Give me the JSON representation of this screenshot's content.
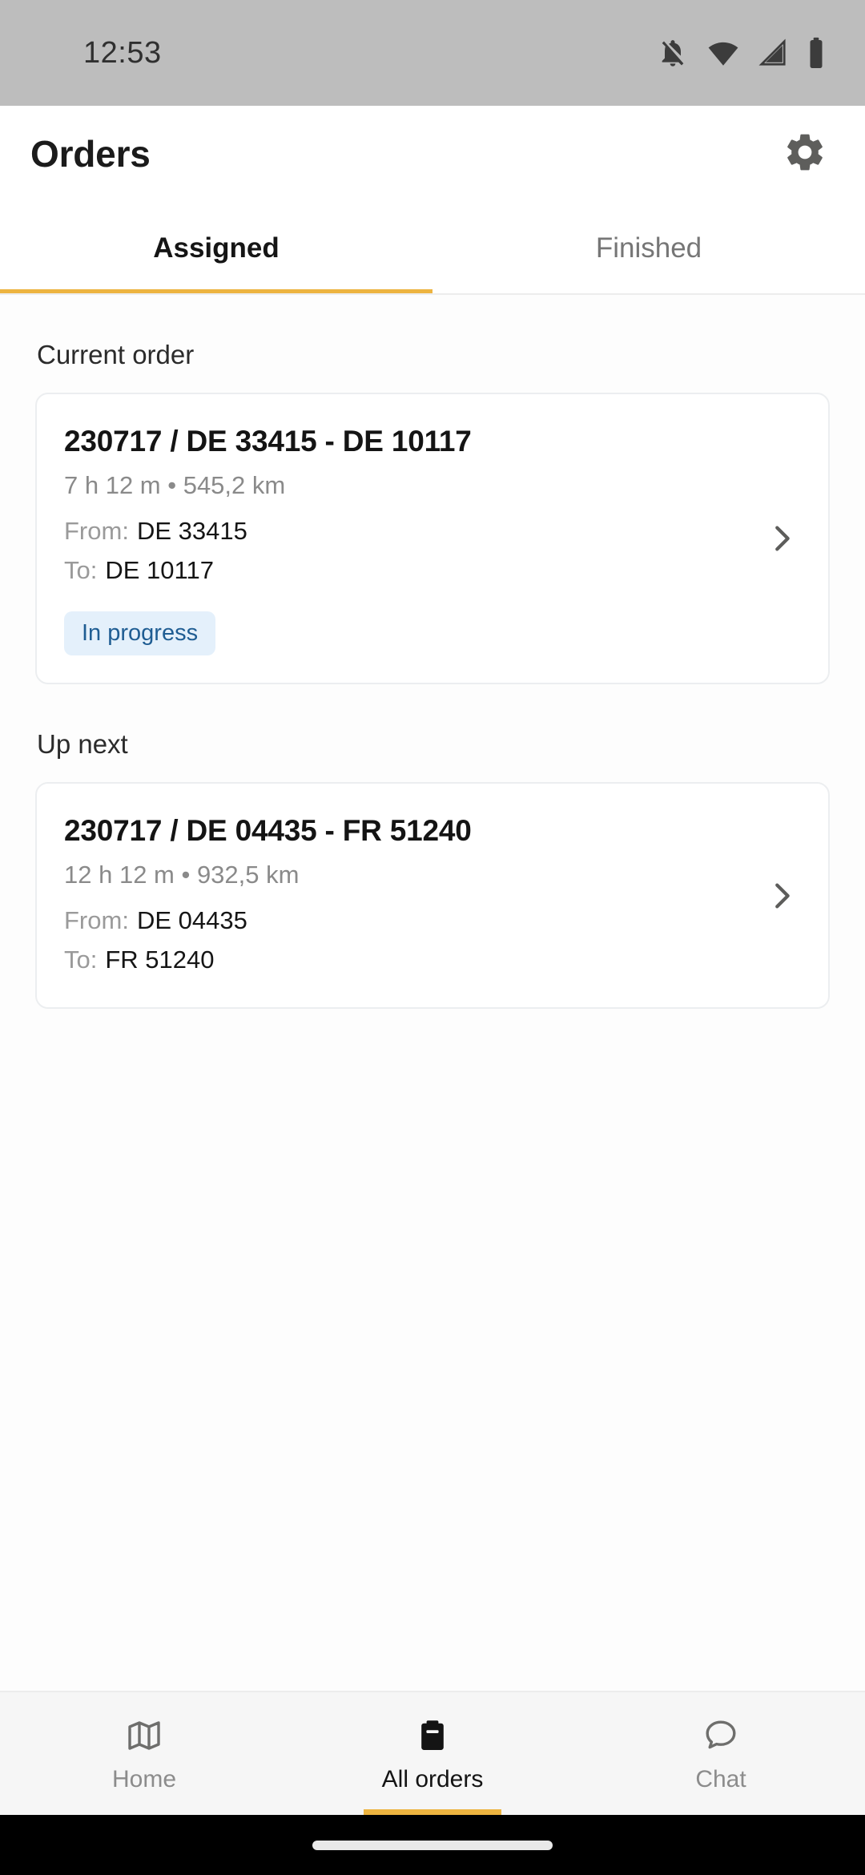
{
  "status_bar": {
    "time": "12:53",
    "icons": [
      "notifications-off-icon",
      "wifi-icon",
      "cellular-signal-icon",
      "battery-icon"
    ]
  },
  "app_bar": {
    "title": "Orders",
    "settings_icon": "gear-icon"
  },
  "tabs": {
    "items": [
      {
        "label": "Assigned",
        "active": true
      },
      {
        "label": "Finished",
        "active": false
      }
    ],
    "indicator_color": "#EDB440"
  },
  "sections": [
    {
      "label": "Current order",
      "order": {
        "title": "230717 / DE 33415 - DE 10117",
        "summary": "7 h 12 m • 545,2 km",
        "from_label": "From:",
        "from_value": "DE 33415",
        "to_label": "To:",
        "to_value": "DE 10117",
        "status_badge": "In progress",
        "badge_bg": "#E4F0FB",
        "badge_fg": "#1F5D93",
        "chevron": "chevron-right-icon"
      }
    },
    {
      "label": "Up next",
      "order": {
        "title": "230717 / DE 04435 - FR 51240",
        "summary": "12 h 12 m • 932,5 km",
        "from_label": "From:",
        "from_value": "DE 04435",
        "to_label": "To:",
        "to_value": "FR 51240",
        "status_badge": null,
        "chevron": "chevron-right-icon"
      }
    }
  ],
  "bottom_nav": {
    "items": [
      {
        "label": "Home",
        "icon": "map-icon",
        "active": false
      },
      {
        "label": "All orders",
        "icon": "clipboard-icon",
        "active": true
      },
      {
        "label": "Chat",
        "icon": "chat-bubble-icon",
        "active": false
      }
    ],
    "indicator_color": "#EDB440"
  }
}
